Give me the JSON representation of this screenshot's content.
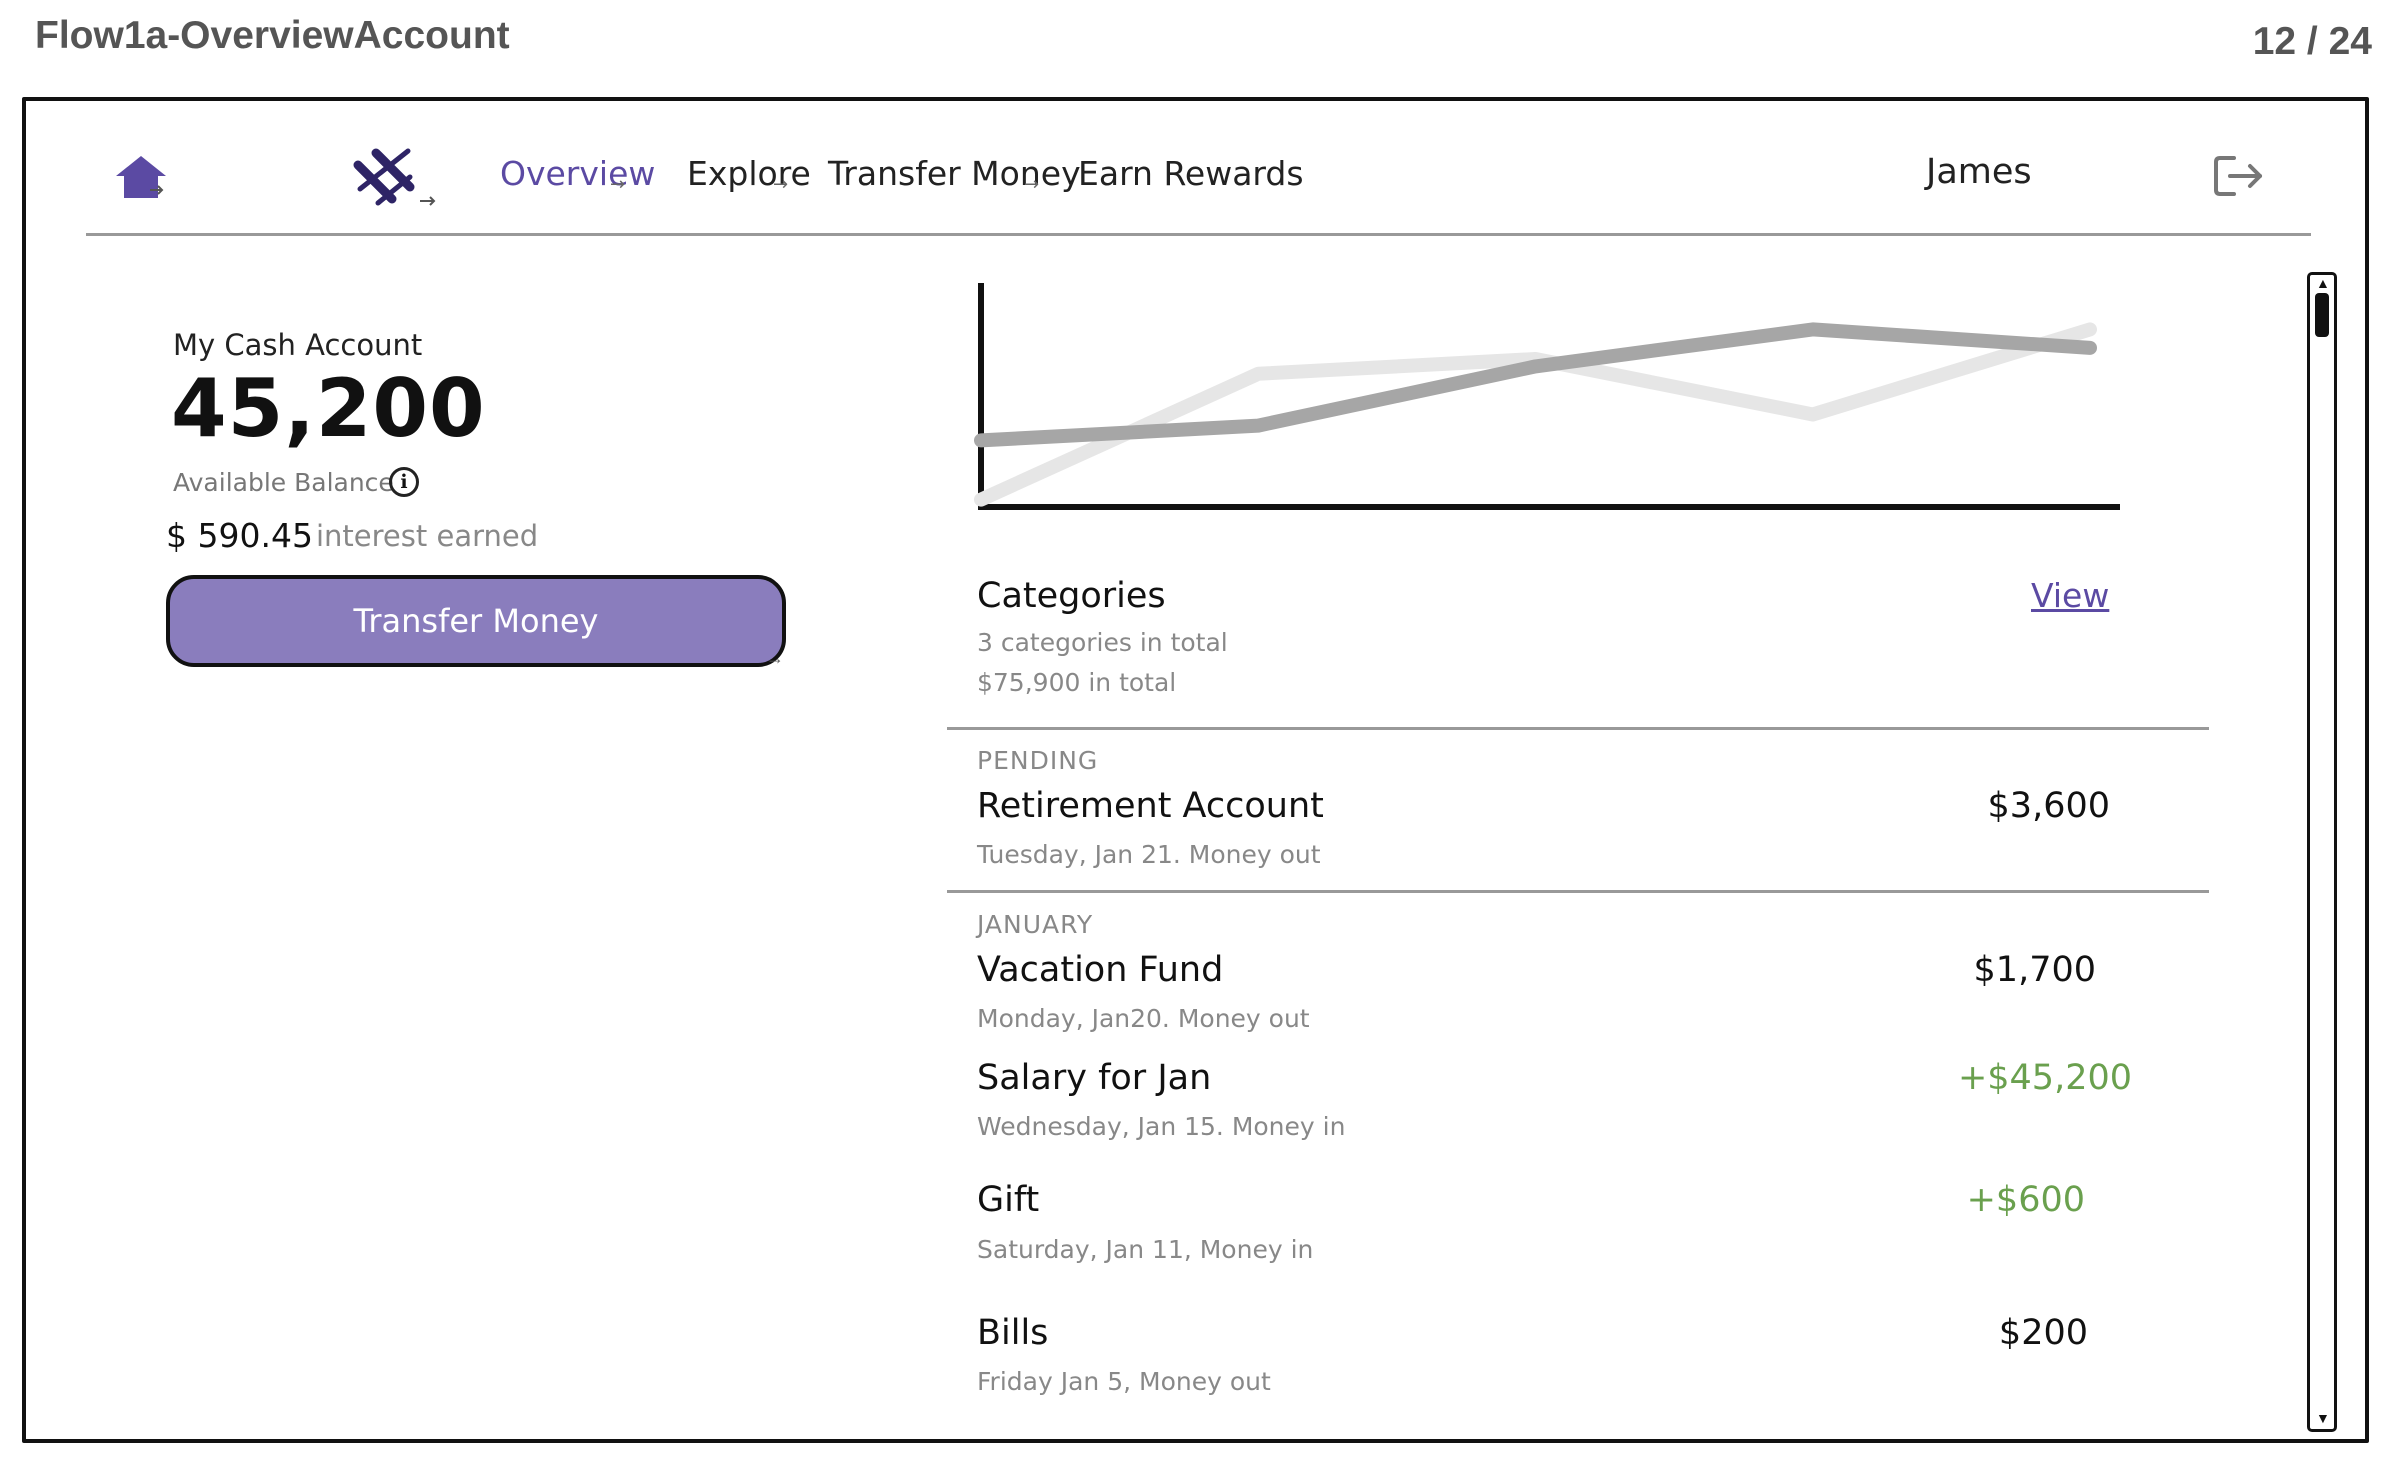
{
  "page": {
    "title": "Flow1a-OverviewAccount",
    "counter": "12 / 24"
  },
  "nav": {
    "home_icon": "home-icon",
    "logo_icon": "brand-logo-icon",
    "items": [
      {
        "label": "Overview",
        "active": true
      },
      {
        "label": "Explore",
        "active": false
      },
      {
        "label": "Transfer Money",
        "active": false
      },
      {
        "label": "Earn Rewards",
        "active": false
      }
    ],
    "user": "James",
    "logout_icon": "logout-icon",
    "accent_color": "#5b4aa3"
  },
  "account": {
    "label": "My Cash Account",
    "balance": "45,200",
    "available_label": "Available Balance",
    "info_icon": "info-icon",
    "interest_value": "$ 590.45",
    "interest_label": "interest earned",
    "transfer_button": "Transfer Money",
    "button_color": "#8a7dbd"
  },
  "chart_data": {
    "type": "line",
    "x": [
      0,
      1,
      2,
      3,
      4
    ],
    "series": [
      {
        "values": [
          1.8,
          2.2,
          3.8,
          4.8,
          4.3
        ],
        "color": "#a6a6a6"
      },
      {
        "values": [
          0.2,
          3.6,
          4.0,
          2.5,
          4.8
        ],
        "color": "#e6e6e6"
      }
    ],
    "title": "",
    "xlabel": "",
    "ylabel": "",
    "ylim": [
      0,
      6
    ],
    "grid": false
  },
  "categories": {
    "title": "Categories",
    "count_text": "3 categories in total",
    "total_text": "$75,900 in total",
    "view_link": "View"
  },
  "transactions": {
    "pending_label": "PENDING",
    "pending": [
      {
        "name": "Retirement Account",
        "date": "Tuesday, Jan 21. Money out",
        "amount": "$3,600",
        "direction": "out"
      }
    ],
    "january_label": "JANUARY",
    "january": [
      {
        "name": "Vacation Fund",
        "date": "Monday, Jan20. Money out",
        "amount": "$1,700",
        "direction": "out"
      },
      {
        "name": "Salary for Jan",
        "date": "Wednesday, Jan 15. Money in",
        "amount": "+$45,200",
        "direction": "in"
      },
      {
        "name": "Gift",
        "date": "Saturday, Jan 11, Money in",
        "amount": "+$600",
        "direction": "in"
      },
      {
        "name": "Bills",
        "date": "Friday Jan 5, Money out",
        "amount": "$200",
        "direction": "out"
      }
    ],
    "money_in_color": "#6aa04e"
  }
}
